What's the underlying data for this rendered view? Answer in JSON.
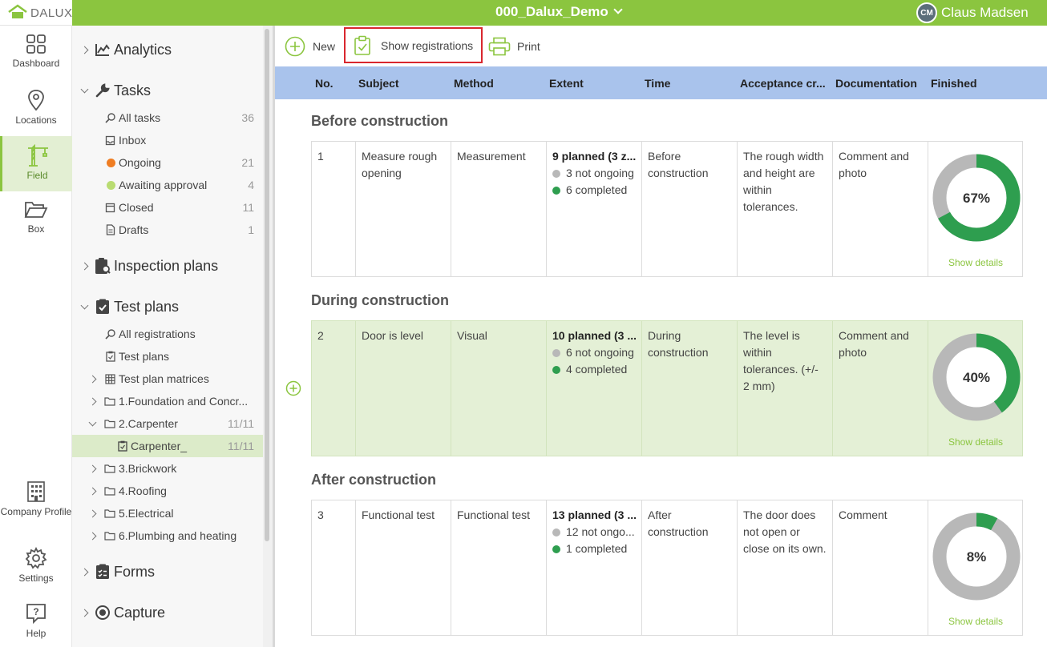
{
  "app": {
    "logo_text": "DALUX",
    "project_title": "000_Dalux_Demo",
    "user_initials": "CM",
    "user_name": "Claus Madsen"
  },
  "rail": {
    "items": [
      {
        "label": "Dashboard",
        "icon": "dashboard-icon"
      },
      {
        "label": "Locations",
        "icon": "location-pin-icon"
      },
      {
        "label": "Field",
        "icon": "crane-icon"
      },
      {
        "label": "Box",
        "icon": "folder-open-icon"
      },
      {
        "label": "Company Profile",
        "icon": "building-icon"
      },
      {
        "label": "Settings",
        "icon": "gear-icon"
      },
      {
        "label": "Help",
        "icon": "help-icon"
      }
    ]
  },
  "tree": {
    "analytics": "Analytics",
    "tasks": "Tasks",
    "task_items": [
      {
        "label": "All tasks",
        "count": "36"
      },
      {
        "label": "Inbox",
        "count": ""
      },
      {
        "label": "Ongoing",
        "count": "21"
      },
      {
        "label": "Awaiting approval",
        "count": "4"
      },
      {
        "label": "Closed",
        "count": "11"
      },
      {
        "label": "Drafts",
        "count": "1"
      }
    ],
    "inspection_plans": "Inspection plans",
    "test_plans": "Test plans",
    "test_items": [
      {
        "label": "All registrations",
        "count": ""
      },
      {
        "label": "Test plans",
        "count": ""
      },
      {
        "label": "Test plan matrices",
        "count": ""
      },
      {
        "label": "1.Foundation and Concr...",
        "count": ""
      },
      {
        "label": "2.Carpenter",
        "count": "11/11"
      },
      {
        "label": "Carpenter_",
        "count": "11/11"
      },
      {
        "label": "3.Brickwork",
        "count": ""
      },
      {
        "label": "4.Roofing",
        "count": ""
      },
      {
        "label": "5.Electrical",
        "count": ""
      },
      {
        "label": "6.Plumbing and heating",
        "count": ""
      }
    ],
    "forms": "Forms",
    "capture": "Capture"
  },
  "toolbar": {
    "new": "New",
    "show_registrations": "Show registrations",
    "print": "Print"
  },
  "table": {
    "columns": [
      "No.",
      "Subject",
      "Method",
      "Extent",
      "Time",
      "Acceptance cr...",
      "Documentation",
      "Finished"
    ],
    "details_label": "Show details",
    "groups": [
      {
        "title": "Before construction",
        "row": {
          "no": "1",
          "subject": "Measure rough opening",
          "method": "Measurement",
          "extent_planned": "9 planned (3 z...",
          "not_ongoing": "3 not ongoing",
          "completed": "6 completed",
          "time": "Before construction",
          "acceptance": "The rough width and height are within tolerances.",
          "documentation": "Comment and photo",
          "finished_pct": "67%",
          "finished_value": 0.67
        }
      },
      {
        "title": "During construction",
        "row": {
          "no": "2",
          "subject": "Door is level",
          "method": "Visual",
          "extent_planned": "10 planned (3 ...",
          "not_ongoing": "6 not ongoing",
          "completed": "4 completed",
          "time": "During construction",
          "acceptance": "The level is within tolerances. (+/- 2 mm)",
          "documentation": "Comment and photo",
          "finished_pct": "40%",
          "finished_value": 0.4
        }
      },
      {
        "title": "After construction",
        "row": {
          "no": "3",
          "subject": "Functional test",
          "method": "Functional test",
          "extent_planned": "13 planned (3 ...",
          "not_ongoing": "12 not ongo...",
          "completed": "1 completed",
          "time": "After construction",
          "acceptance": "The door does not open or close on its own.",
          "documentation": "Comment",
          "finished_pct": "8%",
          "finished_value": 0.08
        }
      }
    ]
  },
  "colors": {
    "brand_green": "#8bc53f",
    "complete_green": "#2e9e4f",
    "not_ongoing_gray": "#b8b8b8",
    "ongoing_orange": "#ef7d22",
    "awaiting_green": "#b9dc72",
    "header_blue": "#a9c3ec"
  }
}
